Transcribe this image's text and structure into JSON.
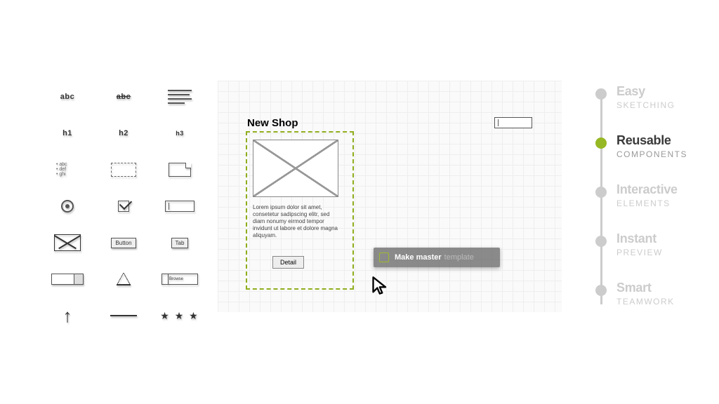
{
  "palette": {
    "text": "abc",
    "striketext": "abc",
    "h1": "h1",
    "h2": "h2",
    "h3": "h3",
    "list_sample": "• abc\n• def\n• ghi",
    "button_label": "Button",
    "tab_label": "Tab",
    "browser_label": "Browse",
    "stars": "★ ★ ★"
  },
  "canvas": {
    "title": "New Shop",
    "lorem": "Lorem ipsum dolor sit amet, consetetur sadipscing elitr, sed diam nonumy eirmod tempor invidunt ut labore et dolore magna aliquyam.",
    "detail_label": "Detail",
    "context_primary": "Make master",
    "context_secondary": "template"
  },
  "features": [
    {
      "title": "Easy",
      "sub": "SKETCHING",
      "active": false
    },
    {
      "title": "Reusable",
      "sub": "COMPONENTS",
      "active": true
    },
    {
      "title": "Interactive",
      "sub": "ELEMENTS",
      "active": false
    },
    {
      "title": "Instant",
      "sub": "PREVIEW",
      "active": false
    },
    {
      "title": "Smart",
      "sub": "TEAMWORK",
      "active": false
    }
  ]
}
